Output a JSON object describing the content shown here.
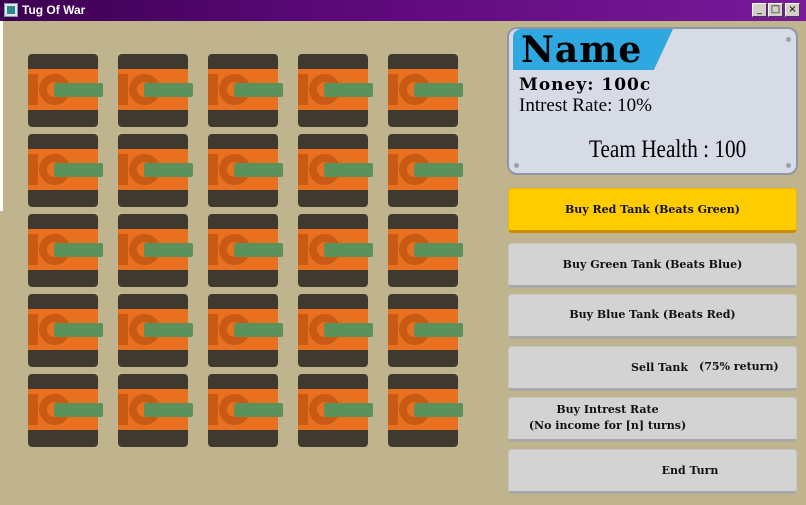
{
  "window": {
    "title": "Tug Of War"
  },
  "tanks": {
    "rows": 5,
    "cols": 5,
    "colors": {
      "body": "#e8701f",
      "track": "#3f3a2f",
      "barrel": "#5b915a"
    }
  },
  "player": {
    "name": "Name",
    "money": "Money: 100c",
    "rate": "Intrest Rate: 10%",
    "health": "Team Health : 100"
  },
  "buttons": {
    "buy_red": "Buy Red Tank (Beats Green)",
    "buy_green": "Buy Green Tank (Beats Blue)",
    "buy_blue": "Buy Blue Tank (Beats Red)",
    "sell_label": "Sell Tank",
    "sell_return": "(75% return)",
    "interest_line1": "Buy Intrest Rate",
    "interest_line2": "(No income for [n] turns)",
    "end_turn": "End Turn"
  }
}
